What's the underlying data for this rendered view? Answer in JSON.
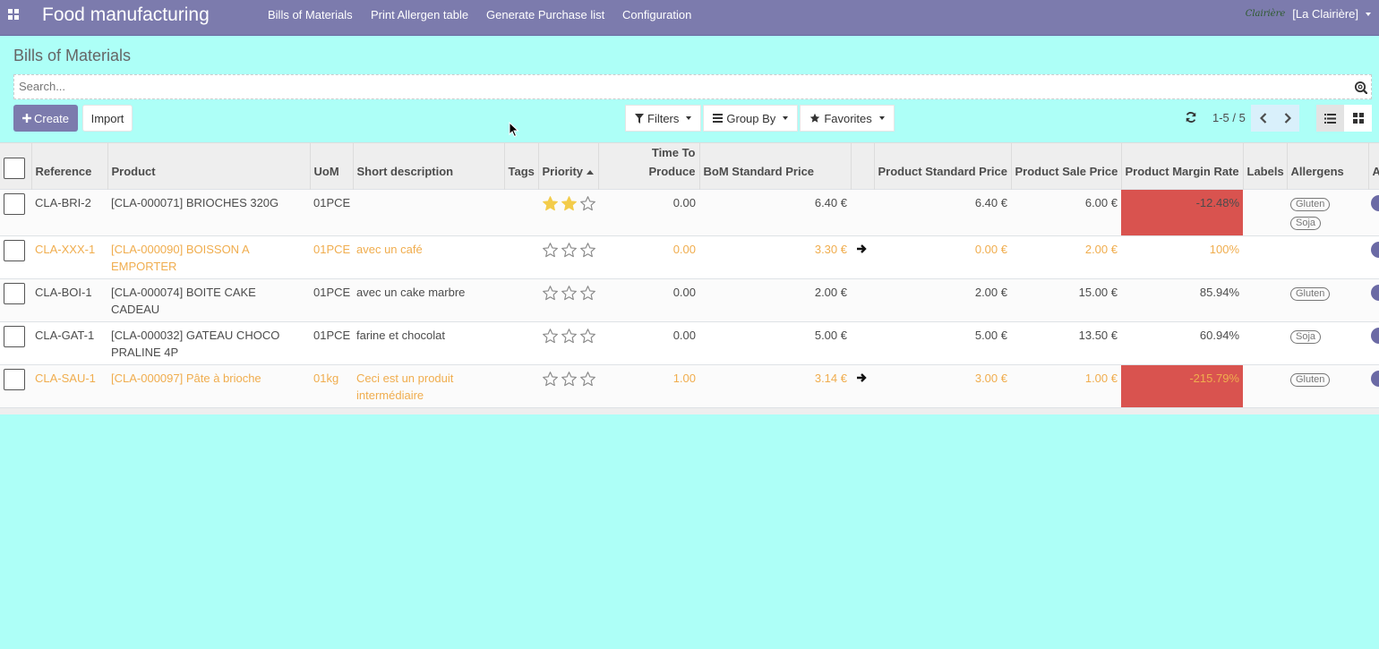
{
  "navbar": {
    "brand": "Food manufacturing",
    "menu": [
      "Bills of Materials",
      "Print Allergen table",
      "Generate Purchase list",
      "Configuration"
    ],
    "company_logo": "Clairière",
    "company": "[La Clairière]"
  },
  "control_panel": {
    "breadcrumb": "Bills of Materials",
    "search_placeholder": "Search...",
    "create_label": "Create",
    "import_label": "Import",
    "filters_label": "Filters",
    "groupby_label": "Group By",
    "favorites_label": "Favorites",
    "pager_value": "1-5 / 5"
  },
  "colors": {
    "navbar": "#7c7bad",
    "background": "#adfff7",
    "warning_text": "#f0ad4e",
    "danger_cell": "#d9534f",
    "star_filled": "#f3cc4a"
  },
  "table": {
    "headers": {
      "reference": "Reference",
      "product": "Product",
      "uom": "UoM",
      "short_description": "Short description",
      "tags": "Tags",
      "priority": "Priority",
      "time_to_produce_1": "Time To",
      "time_to_produce_2": "Produce",
      "bom_standard_price": "BoM Standard Price",
      "product_standard_price": "Product Standard Price",
      "product_sale_price": "Product Sale Price",
      "product_margin_rate": "Product Margin Rate",
      "labels": "Labels",
      "allergens": "Allergens",
      "active": "Active"
    },
    "rows": [
      {
        "reference": "CLA-BRI-2",
        "product": "[CLA-000071] BRIOCHES 320G",
        "uom": "01PCE",
        "short_description": "",
        "priority": 2,
        "time_to_produce": "0.00",
        "bom_standard_price": "6.40 €",
        "arrow": false,
        "product_standard_price": "6.40 €",
        "product_sale_price": "6.00 €",
        "product_margin_rate": "-12.48%",
        "margin_danger": true,
        "allergens": [
          "Gluten",
          "Soja"
        ],
        "active": true,
        "warning": false
      },
      {
        "reference": "CLA-XXX-1",
        "product": "[CLA-000090] BOISSON A EMPORTER",
        "uom": "01PCE",
        "short_description": "avec un café",
        "priority": 0,
        "time_to_produce": "0.00",
        "bom_standard_price": "3.30 €",
        "arrow": true,
        "product_standard_price": "0.00 €",
        "product_sale_price": "2.00 €",
        "product_margin_rate": "100%",
        "margin_danger": false,
        "allergens": [],
        "active": true,
        "warning": true
      },
      {
        "reference": "CLA-BOI-1",
        "product": "[CLA-000074] BOITE CAKE CADEAU",
        "uom": "01PCE",
        "short_description": "avec un cake marbre",
        "priority": 0,
        "time_to_produce": "0.00",
        "bom_standard_price": "2.00 €",
        "arrow": false,
        "product_standard_price": "2.00 €",
        "product_sale_price": "15.00 €",
        "product_margin_rate": "85.94%",
        "margin_danger": false,
        "allergens": [
          "Gluten"
        ],
        "active": true,
        "warning": false
      },
      {
        "reference": "CLA-GAT-1",
        "product": "[CLA-000032] GATEAU CHOCO PRALINE 4P",
        "uom": "01PCE",
        "short_description": "farine et chocolat",
        "priority": 0,
        "time_to_produce": "0.00",
        "bom_standard_price": "5.00 €",
        "arrow": false,
        "product_standard_price": "5.00 €",
        "product_sale_price": "13.50 €",
        "product_margin_rate": "60.94%",
        "margin_danger": false,
        "allergens": [
          "Soja"
        ],
        "active": true,
        "warning": false
      },
      {
        "reference": "CLA-SAU-1",
        "product": "[CLA-000097] Pâte à brioche",
        "uom": "01kg",
        "short_description": "Ceci est un produit intermédiaire",
        "priority": 0,
        "time_to_produce": "1.00",
        "bom_standard_price": "3.14 €",
        "arrow": true,
        "product_standard_price": "3.00 €",
        "product_sale_price": "1.00 €",
        "product_margin_rate": "-215.79%",
        "margin_danger": true,
        "allergens": [
          "Gluten"
        ],
        "active": true,
        "warning": true
      }
    ]
  }
}
